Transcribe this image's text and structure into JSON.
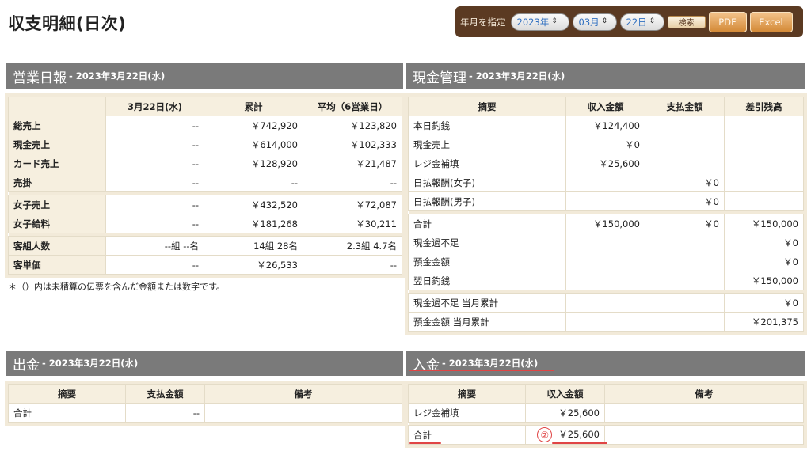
{
  "page_title": "収支明細(日次)",
  "toolbar": {
    "label": "年月を指定",
    "year": "2023年",
    "month": "03月",
    "day": "22日",
    "search": "検索",
    "pdf": "PDF",
    "excel": "Excel",
    "chevron_icon": "updown-chevron-icon"
  },
  "colors": {
    "toolbar_bg": "#5b3a22",
    "panel_head_bg": "#7a7a7a",
    "table_header_bg": "#f6efdf",
    "button_accent": "#d48a37",
    "annotation_red": "#e04545",
    "select_text": "#2f6fc0"
  },
  "sales": {
    "title": "営業日報",
    "date": "- 2023年3月22日(水)",
    "columns": [
      "",
      "3月22日(水)",
      "累計",
      "平均（6営業日）"
    ],
    "rows": [
      {
        "label": "総売上",
        "day": "--",
        "total": "￥742,920",
        "avg": "￥123,820"
      },
      {
        "label": "現金売上",
        "day": "--",
        "total": "￥614,000",
        "avg": "￥102,333"
      },
      {
        "label": "カード売上",
        "day": "--",
        "total": "￥128,920",
        "avg": "￥21,487"
      },
      {
        "label": "売掛",
        "day": "--",
        "total": "--",
        "avg": "--"
      },
      {
        "label": "女子売上",
        "day": "--",
        "total": "￥432,520",
        "avg": "￥72,087"
      },
      {
        "label": "女子給料",
        "day": "--",
        "total": "￥181,268",
        "avg": "￥30,211"
      },
      {
        "label": "客組人数",
        "day": "--組 --名",
        "total": "14組 28名",
        "avg": "2.3組 4.7名"
      },
      {
        "label": "客単価",
        "day": "--",
        "total": "￥26,533",
        "avg": "--"
      }
    ],
    "note": "＊（）内は未精算の伝票を含んだ金額または数字です。"
  },
  "cash": {
    "title": "現金管理",
    "date": "- 2023年3月22日(水)",
    "columns": [
      "摘要",
      "収入金額",
      "支払金額",
      "差引残高"
    ],
    "rows": [
      {
        "label": "本日釣銭",
        "in": "￥124,400",
        "out": "",
        "bal": ""
      },
      {
        "label": "現金売上",
        "in": "￥0",
        "out": "",
        "bal": ""
      },
      {
        "label": "レジ金補填",
        "in": "￥25,600",
        "out": "",
        "bal": ""
      },
      {
        "label": "日払報酬(女子)",
        "in": "",
        "out": "￥0",
        "bal": ""
      },
      {
        "label": "日払報酬(男子)",
        "in": "",
        "out": "￥0",
        "bal": ""
      },
      {
        "label": "合計",
        "in": "￥150,000",
        "out": "￥0",
        "bal": "￥150,000"
      },
      {
        "label": "現金過不足",
        "in": "",
        "out": "",
        "bal": "￥0"
      },
      {
        "label": "預金金額",
        "in": "",
        "out": "",
        "bal": "￥0"
      },
      {
        "label": "翌日釣銭",
        "in": "",
        "out": "",
        "bal": "￥150,000"
      },
      {
        "label": "現金過不足 当月累計",
        "in": "",
        "out": "",
        "bal": "￥0"
      },
      {
        "label": "預金金額 当月累計",
        "in": "",
        "out": "",
        "bal": "￥201,375"
      }
    ]
  },
  "payout": {
    "title": "出金",
    "date": "- 2023年3月22日(水)",
    "columns": [
      "摘要",
      "支払金額",
      "備考"
    ],
    "rows": [
      {
        "label": "合計",
        "amount": "--",
        "note": ""
      }
    ]
  },
  "income": {
    "title": "入金",
    "date": "- 2023年3月22日(水)",
    "columns": [
      "摘要",
      "収入金額",
      "備考"
    ],
    "rows": [
      {
        "label": "レジ金補填",
        "amount": "￥25,600",
        "note": ""
      },
      {
        "label": "合計",
        "amount": "￥25,600",
        "note": ""
      }
    ],
    "annotation": "②"
  }
}
